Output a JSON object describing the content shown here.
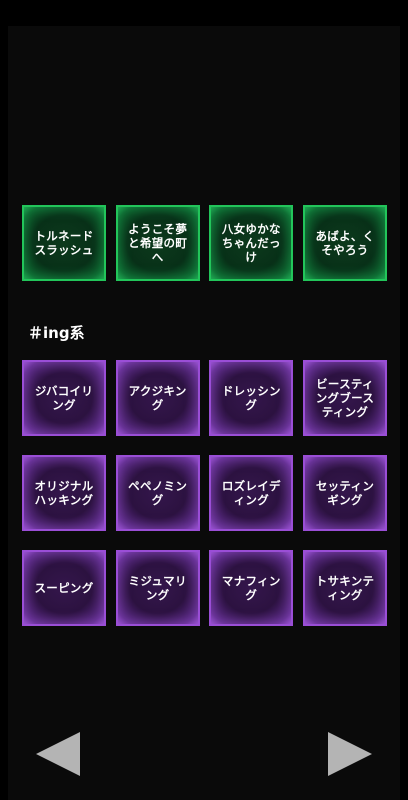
{
  "top_row": [
    {
      "label": "トルネード\nスラッシュ"
    },
    {
      "label": "ようこそ夢\nと希望の町\nへ"
    },
    {
      "label": "八女ゆかな\nちゃんだっ\nけ"
    },
    {
      "label": "あばよ、く\nそやろう"
    }
  ],
  "section": {
    "title": "＃ing系"
  },
  "ing_rows": [
    [
      {
        "label": "ジバコイリ\nング"
      },
      {
        "label": "アクジキン\nグ"
      },
      {
        "label": "ドレッシン\nグ"
      },
      {
        "label": "ビースティ\nングブース\nティング"
      }
    ],
    [
      {
        "label": "オリジナル\nハッキング"
      },
      {
        "label": "ペペノミン\nグ"
      },
      {
        "label": "ロズレイデ\nィング"
      },
      {
        "label": "セッティン\nギング"
      }
    ],
    [
      {
        "label": "スーピング"
      },
      {
        "label": "ミジュマリ\nング"
      },
      {
        "label": "マナフィン\nグ"
      },
      {
        "label": "トサキンテ\nィング"
      }
    ]
  ],
  "colors": {
    "green_border": "#22c55a",
    "purple_border": "#9a4ed6",
    "nav_arrow": "#b4b4b4"
  },
  "icons": {
    "prev": "triangle-left-icon",
    "next": "triangle-right-icon"
  }
}
